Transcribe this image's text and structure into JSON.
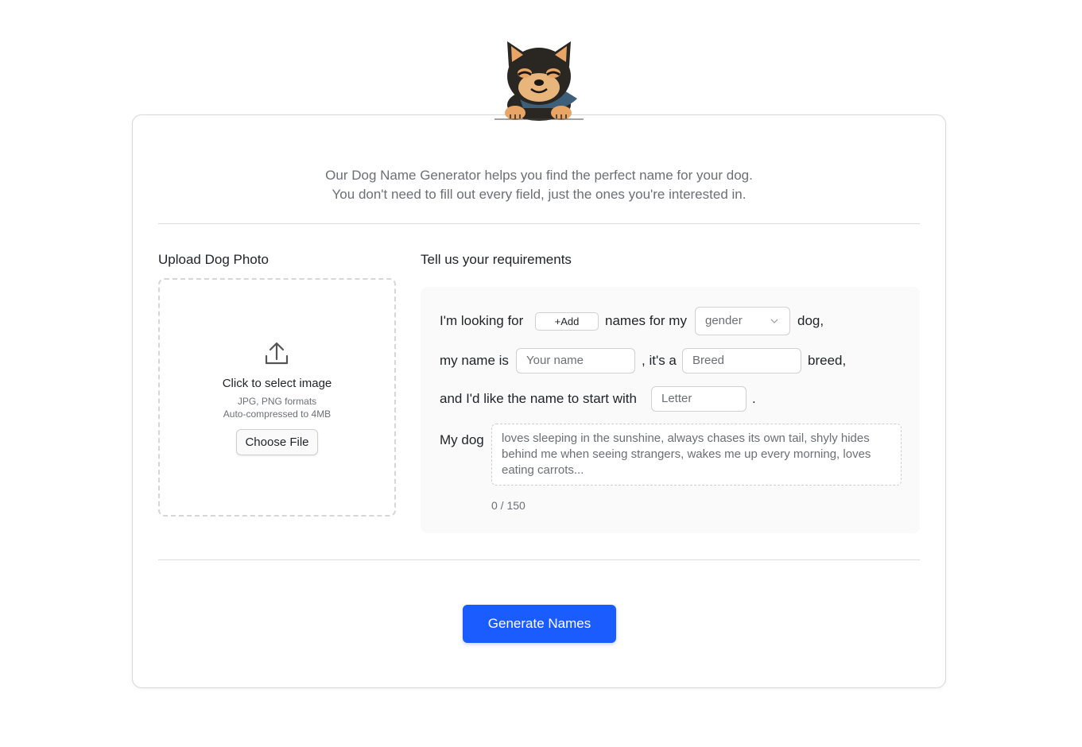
{
  "intro": {
    "line1": "Our Dog Name Generator helps you find the perfect name for your dog.",
    "line2": "You don't need to fill out every field, just the ones you're interested in."
  },
  "upload": {
    "title": "Upload Dog Photo",
    "main_text": "Click to select image",
    "formats": "JPG, PNG formats",
    "compression": "Auto-compressed to 4MB",
    "button_label": "Choose File",
    "icon": "upload-icon"
  },
  "requirements": {
    "title": "Tell us your requirements",
    "line1": {
      "prefix": "I'm looking for",
      "add_label": "+Add",
      "middle": "names for my",
      "gender_value": "gender",
      "suffix": "dog,"
    },
    "line2": {
      "prefix": "my name is",
      "name_placeholder": "Your name",
      "middle": ", it's a",
      "breed_placeholder": "Breed",
      "suffix": "breed,"
    },
    "line3": {
      "prefix": "and I'd like the name to start with",
      "letter_placeholder": "Letter",
      "suffix": "."
    },
    "description": {
      "label": "My dog",
      "placeholder": "loves sleeping in the sunshine, always chases its own tail, shyly hides behind me when seeing strangers, wakes me up every morning, loves eating carrots...",
      "counter": "0 / 150"
    }
  },
  "generate_button": "Generate Names",
  "colors": {
    "accent": "#1a5cff",
    "muted_text": "#6b6f76",
    "panel_bg": "#fafafa",
    "border": "#d9d9d9"
  }
}
